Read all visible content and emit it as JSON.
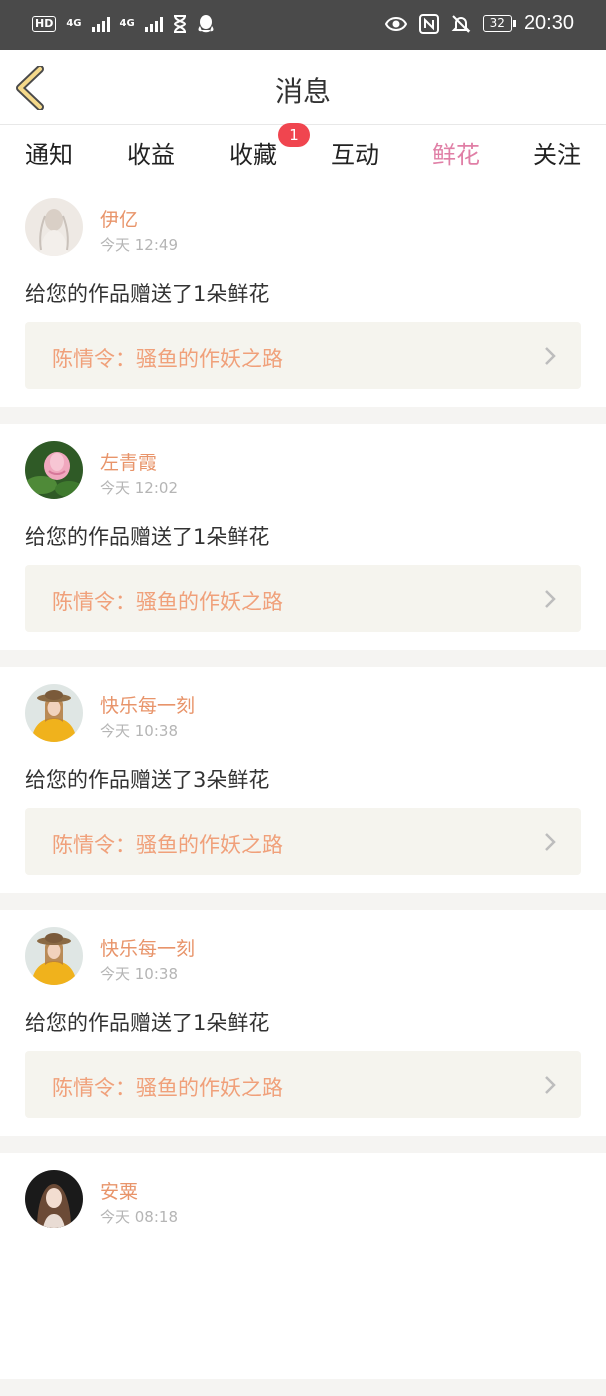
{
  "status_bar": {
    "hd_label": "HD",
    "net1": "4G",
    "net2": "4G",
    "battery": "32",
    "time": "20:30"
  },
  "header": {
    "title": "消息",
    "back_icon": "back-chevron-icon"
  },
  "tabs": [
    {
      "label": "通知"
    },
    {
      "label": "收益"
    },
    {
      "label": "收藏",
      "badge": "1"
    },
    {
      "label": "互动"
    },
    {
      "label": "鲜花",
      "active": true
    },
    {
      "label": "关注"
    }
  ],
  "messages": [
    {
      "name": "伊亿",
      "time": "今天 12:49",
      "text": "给您的作品赠送了1朵鲜花",
      "work": "陈情令：骚鱼的作妖之路"
    },
    {
      "name": "左青霞",
      "time": "今天 12:02",
      "text": "给您的作品赠送了1朵鲜花",
      "work": "陈情令：骚鱼的作妖之路"
    },
    {
      "name": "快乐每一刻",
      "time": "今天 10:38",
      "text": "给您的作品赠送了3朵鲜花",
      "work": "陈情令：骚鱼的作妖之路"
    },
    {
      "name": "快乐每一刻",
      "time": "今天 10:38",
      "text": "给您的作品赠送了1朵鲜花",
      "work": "陈情令：骚鱼的作妖之路"
    },
    {
      "name": "安粟",
      "time": "今天 08:18",
      "text": "",
      "work": ""
    }
  ],
  "colors": {
    "accent": "#e07fa6",
    "name": "#e8946a",
    "work_title": "#f0a07a",
    "badge": "#f0454f"
  }
}
